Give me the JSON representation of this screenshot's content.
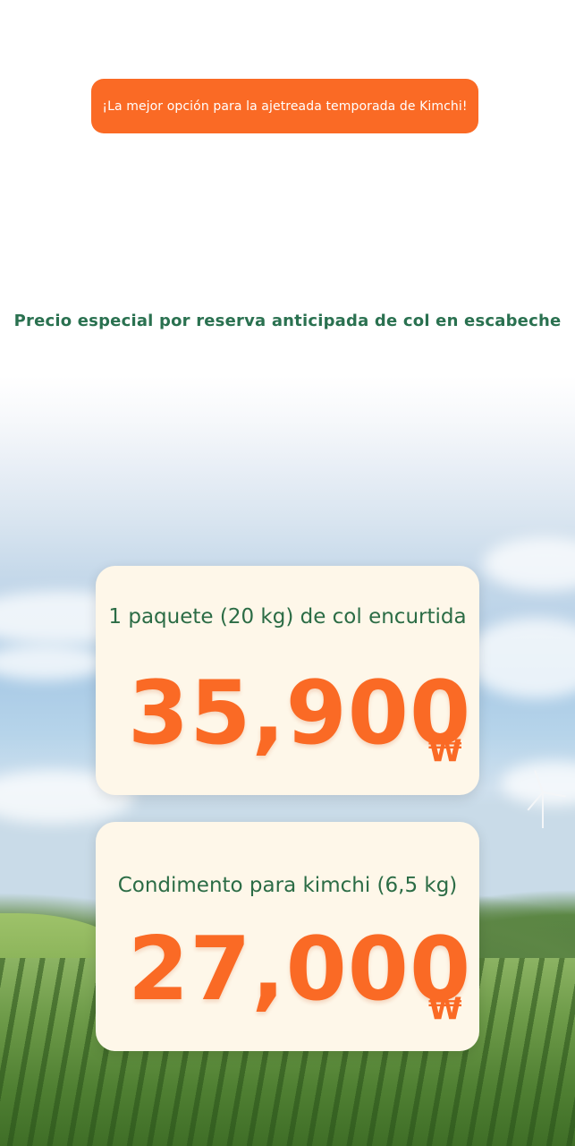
{
  "header": {
    "banner_text": "¡La mejor opción para la ajetreada temporada de Kimchi!"
  },
  "promo": {
    "subtitle": "Precio especial por reserva anticipada de col en escabeche"
  },
  "products": [
    {
      "name": "1 paquete (20 kg) de col encurtida",
      "price": "35,900",
      "currency": "₩"
    },
    {
      "name": "Condimento para kimchi (6,5 kg)",
      "price": "27,000",
      "currency": "₩"
    }
  ],
  "colors": {
    "accent": "#fa6a25",
    "text_green": "#2a7150",
    "card_bg": "#fef7e9"
  }
}
